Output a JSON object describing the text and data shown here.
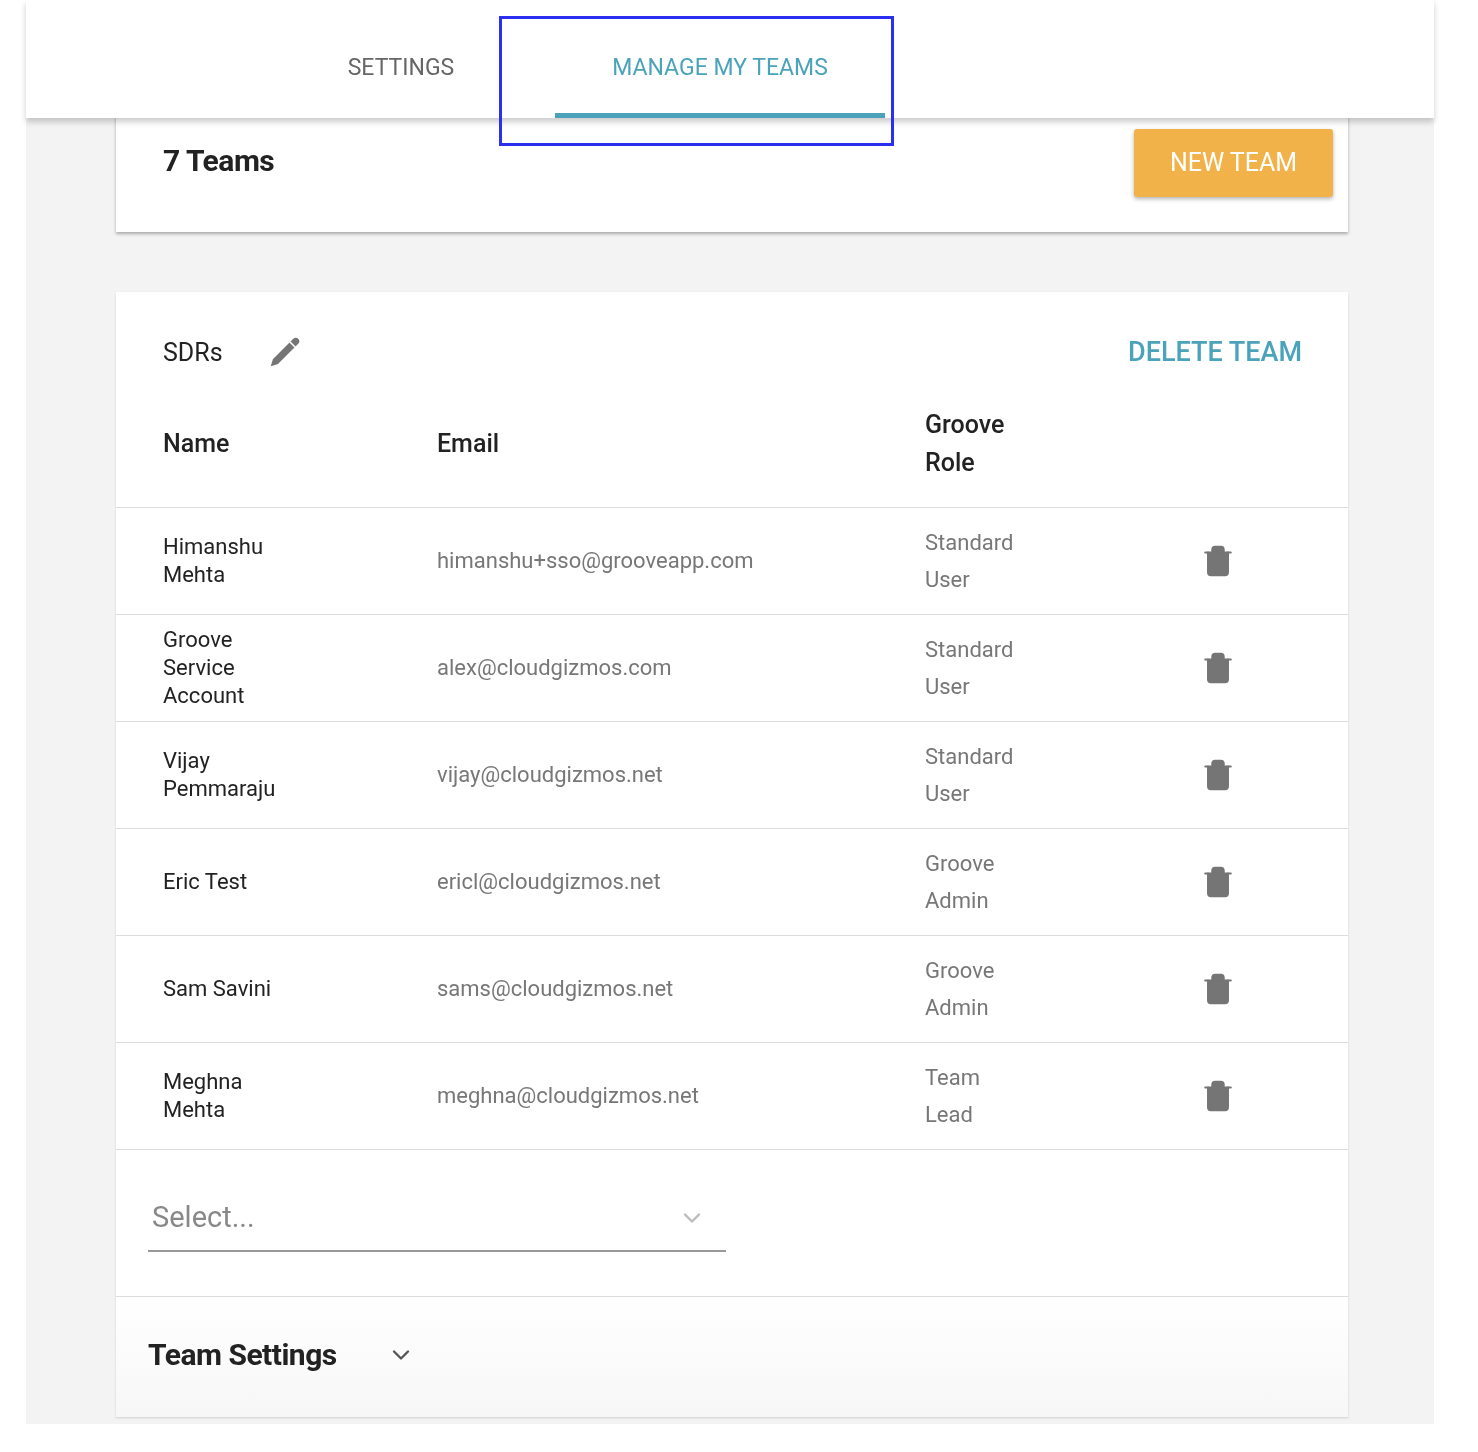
{
  "tabs": [
    {
      "label": "SETTINGS",
      "selected": false
    },
    {
      "label": "MANAGE MY TEAMS",
      "selected": true
    }
  ],
  "summary": {
    "title": "7 Teams",
    "button": "NEW TEAM"
  },
  "team": {
    "name": "SDRs",
    "delete": "DELETE TEAM",
    "columns": [
      "Name",
      "Email",
      "Groove Role"
    ],
    "rows": [
      {
        "name": "Himanshu Mehta",
        "email": "himanshu+sso@grooveapp.com",
        "role": "Standard User"
      },
      {
        "name": "Groove Service Account",
        "email": "alex@cloudgizmos.com",
        "role": "Standard User"
      },
      {
        "name": "Vijay Pemmaraju",
        "email": "vijay@cloudgizmos.net",
        "role": "Standard User"
      },
      {
        "name": "Eric Test",
        "email": "ericl@cloudgizmos.net",
        "role": "Groove Admin"
      },
      {
        "name": "Sam Savini",
        "email": "sams@cloudgizmos.net",
        "role": "Groove Admin"
      },
      {
        "name": "Meghna Mehta",
        "email": "meghna@cloudgizmos.net",
        "role": "Team Lead"
      }
    ],
    "select": {
      "placeholder": "Select..."
    },
    "settings": {
      "title": "Team Settings",
      "expanded": false
    }
  }
}
